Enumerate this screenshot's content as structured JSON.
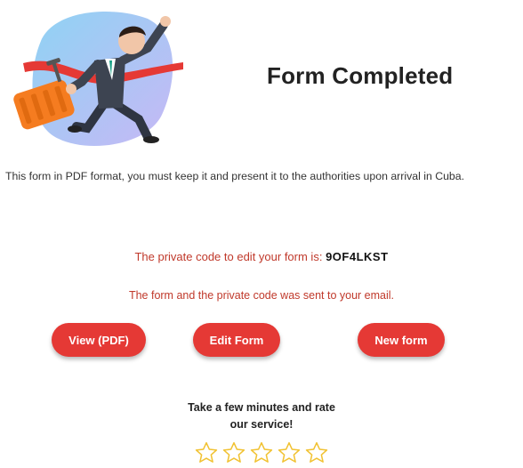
{
  "header": {
    "title": "Form Completed",
    "illustration_icon": "running-businessman-finish-line-icon"
  },
  "notice": {
    "text": "This form in PDF format, you must keep it and present it to the authorities upon arrival in Cuba."
  },
  "code": {
    "label": "The private code to edit your form is:",
    "value": "9OF4LKST"
  },
  "email_notice": "The form and the private code was sent to your email.",
  "buttons": {
    "view_pdf": "View (PDF)",
    "edit_form": "Edit Form",
    "new_form": "New form"
  },
  "rating": {
    "prompt_line1": "Take a few minutes and rate",
    "prompt_line2": "our service!",
    "max_stars": 5,
    "selected": 0,
    "star_icon": "star-outline-icon"
  },
  "colors": {
    "accent": "#e53935",
    "message_red": "#c0392b",
    "star": "#f1c232"
  }
}
